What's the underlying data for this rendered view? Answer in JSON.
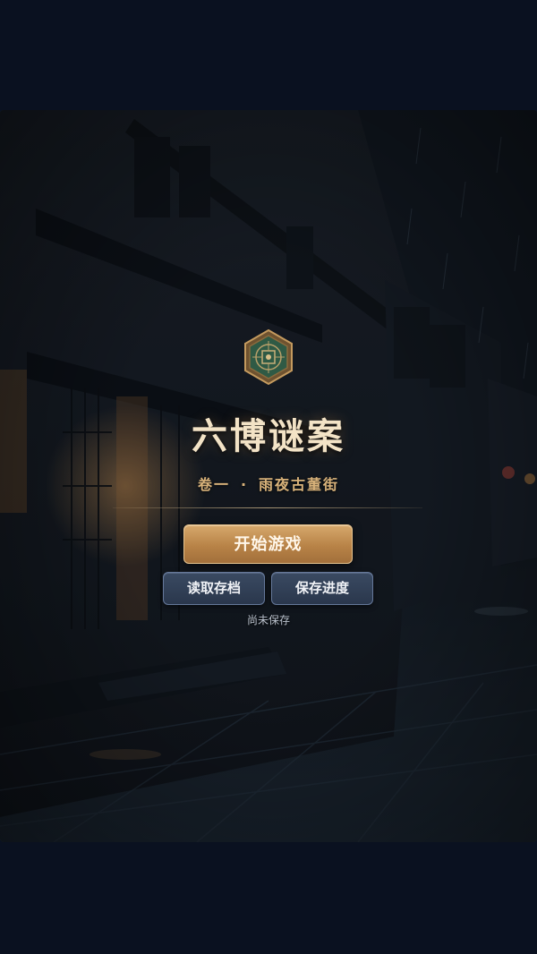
{
  "game": {
    "title": "六博谜案",
    "subtitle_volume": "卷一",
    "subtitle_separator": "·",
    "subtitle_chapter": "雨夜古董街"
  },
  "menu": {
    "start_label": "开始游戏",
    "load_label": "读取存档",
    "save_label": "保存进度",
    "save_status": "尚未保存"
  },
  "emblem": {
    "icon": "liubo-board-emblem-icon",
    "frame_color": "#8a6a3c",
    "face_color": "#2f5a45"
  },
  "colors": {
    "page_background": "#0a1120",
    "title": "#f3e3c6",
    "subtitle": "#d8b27a",
    "start_button": "#b88347",
    "secondary_button": "#2a374c"
  },
  "background": {
    "scene": "rainy-night-old-street"
  }
}
